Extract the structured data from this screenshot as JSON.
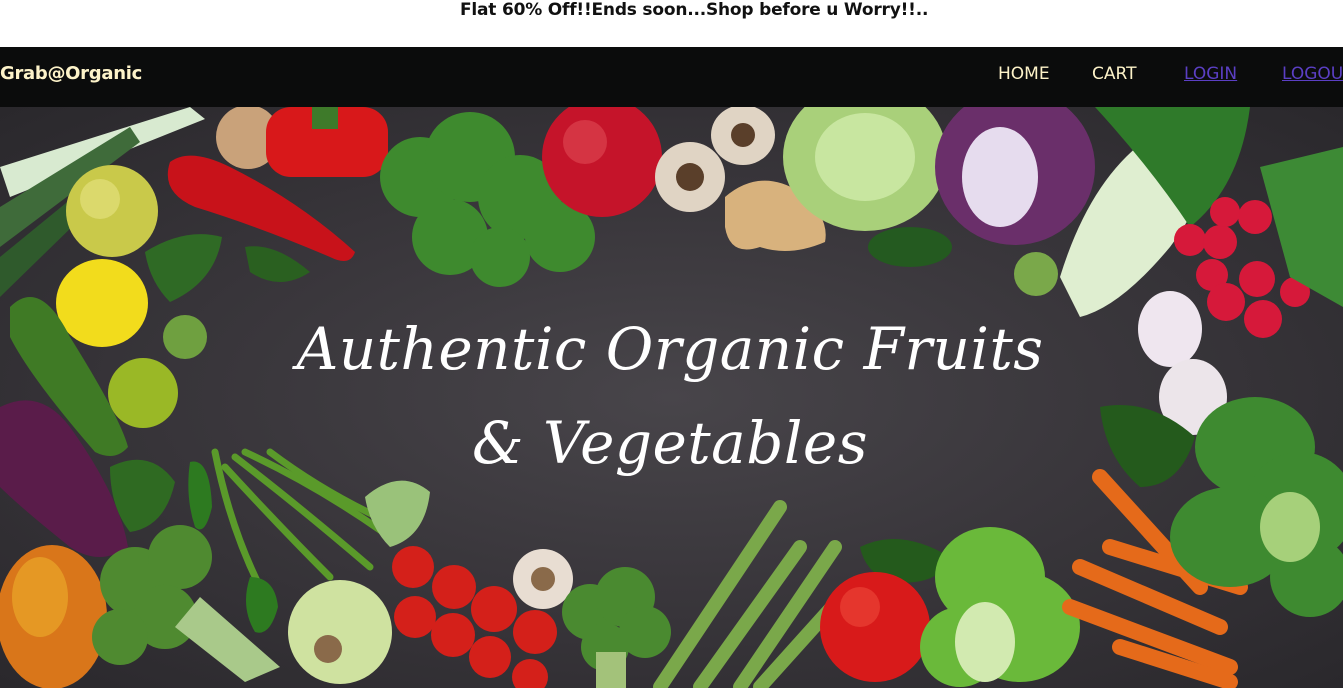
{
  "promo": {
    "text": "Flat 60% Off!!Ends soon...Shop before u Worry!!.."
  },
  "navbar": {
    "brand": "Grab@Organic",
    "links": [
      {
        "label": "HOME"
      },
      {
        "label": "CART"
      },
      {
        "label": "LOGIN"
      },
      {
        "label": "LOGOUT"
      }
    ]
  },
  "hero": {
    "title": "Authentic Organic Fruits & Vegetables"
  },
  "colors": {
    "navbar_bg": "#0b0c0c",
    "nav_text": "#fdf3c9",
    "nav_link_visited": "#5b3fc4",
    "hero_text": "#ffffff"
  }
}
